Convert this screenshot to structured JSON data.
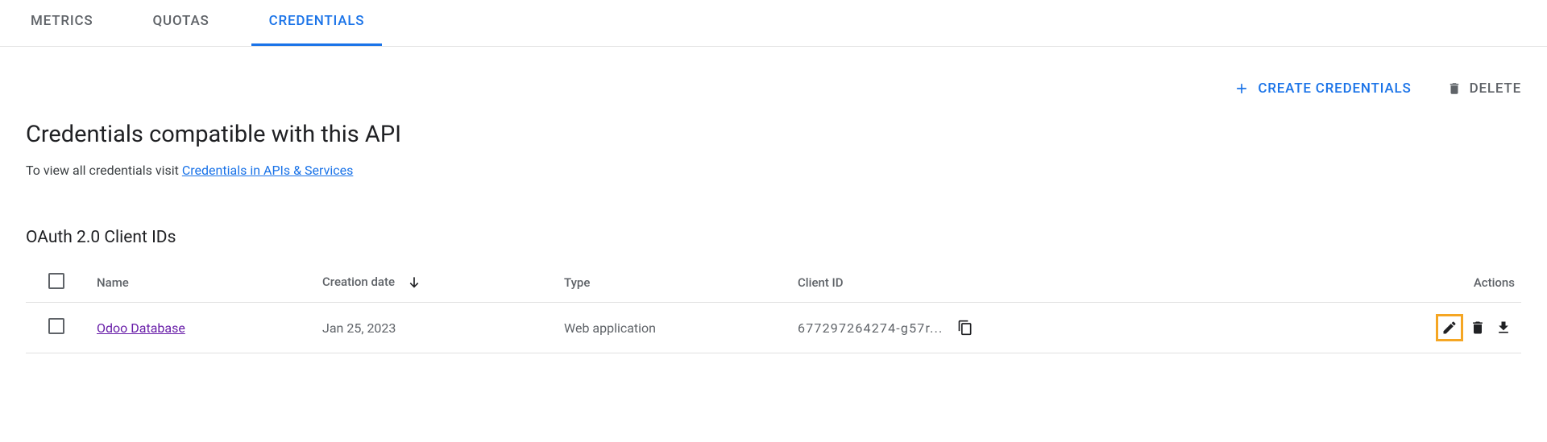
{
  "tabs": {
    "metrics": "METRICS",
    "quotas": "QUOTAS",
    "credentials": "CREDENTIALS"
  },
  "buttons": {
    "create": "CREATE CREDENTIALS",
    "delete": "DELETE"
  },
  "page": {
    "title": "Credentials compatible with this API",
    "subtitle_prefix": "To view all credentials visit ",
    "subtitle_link": "Credentials in APIs & Services"
  },
  "section": {
    "title": "OAuth 2.0 Client IDs"
  },
  "table": {
    "headers": {
      "name": "Name",
      "creation_date": "Creation date",
      "type": "Type",
      "client_id": "Client ID",
      "actions": "Actions"
    },
    "rows": [
      {
        "name": "Odoo Database",
        "creation_date": "Jan 25, 2023",
        "type": "Web application",
        "client_id": "677297264274-g57r..."
      }
    ]
  }
}
